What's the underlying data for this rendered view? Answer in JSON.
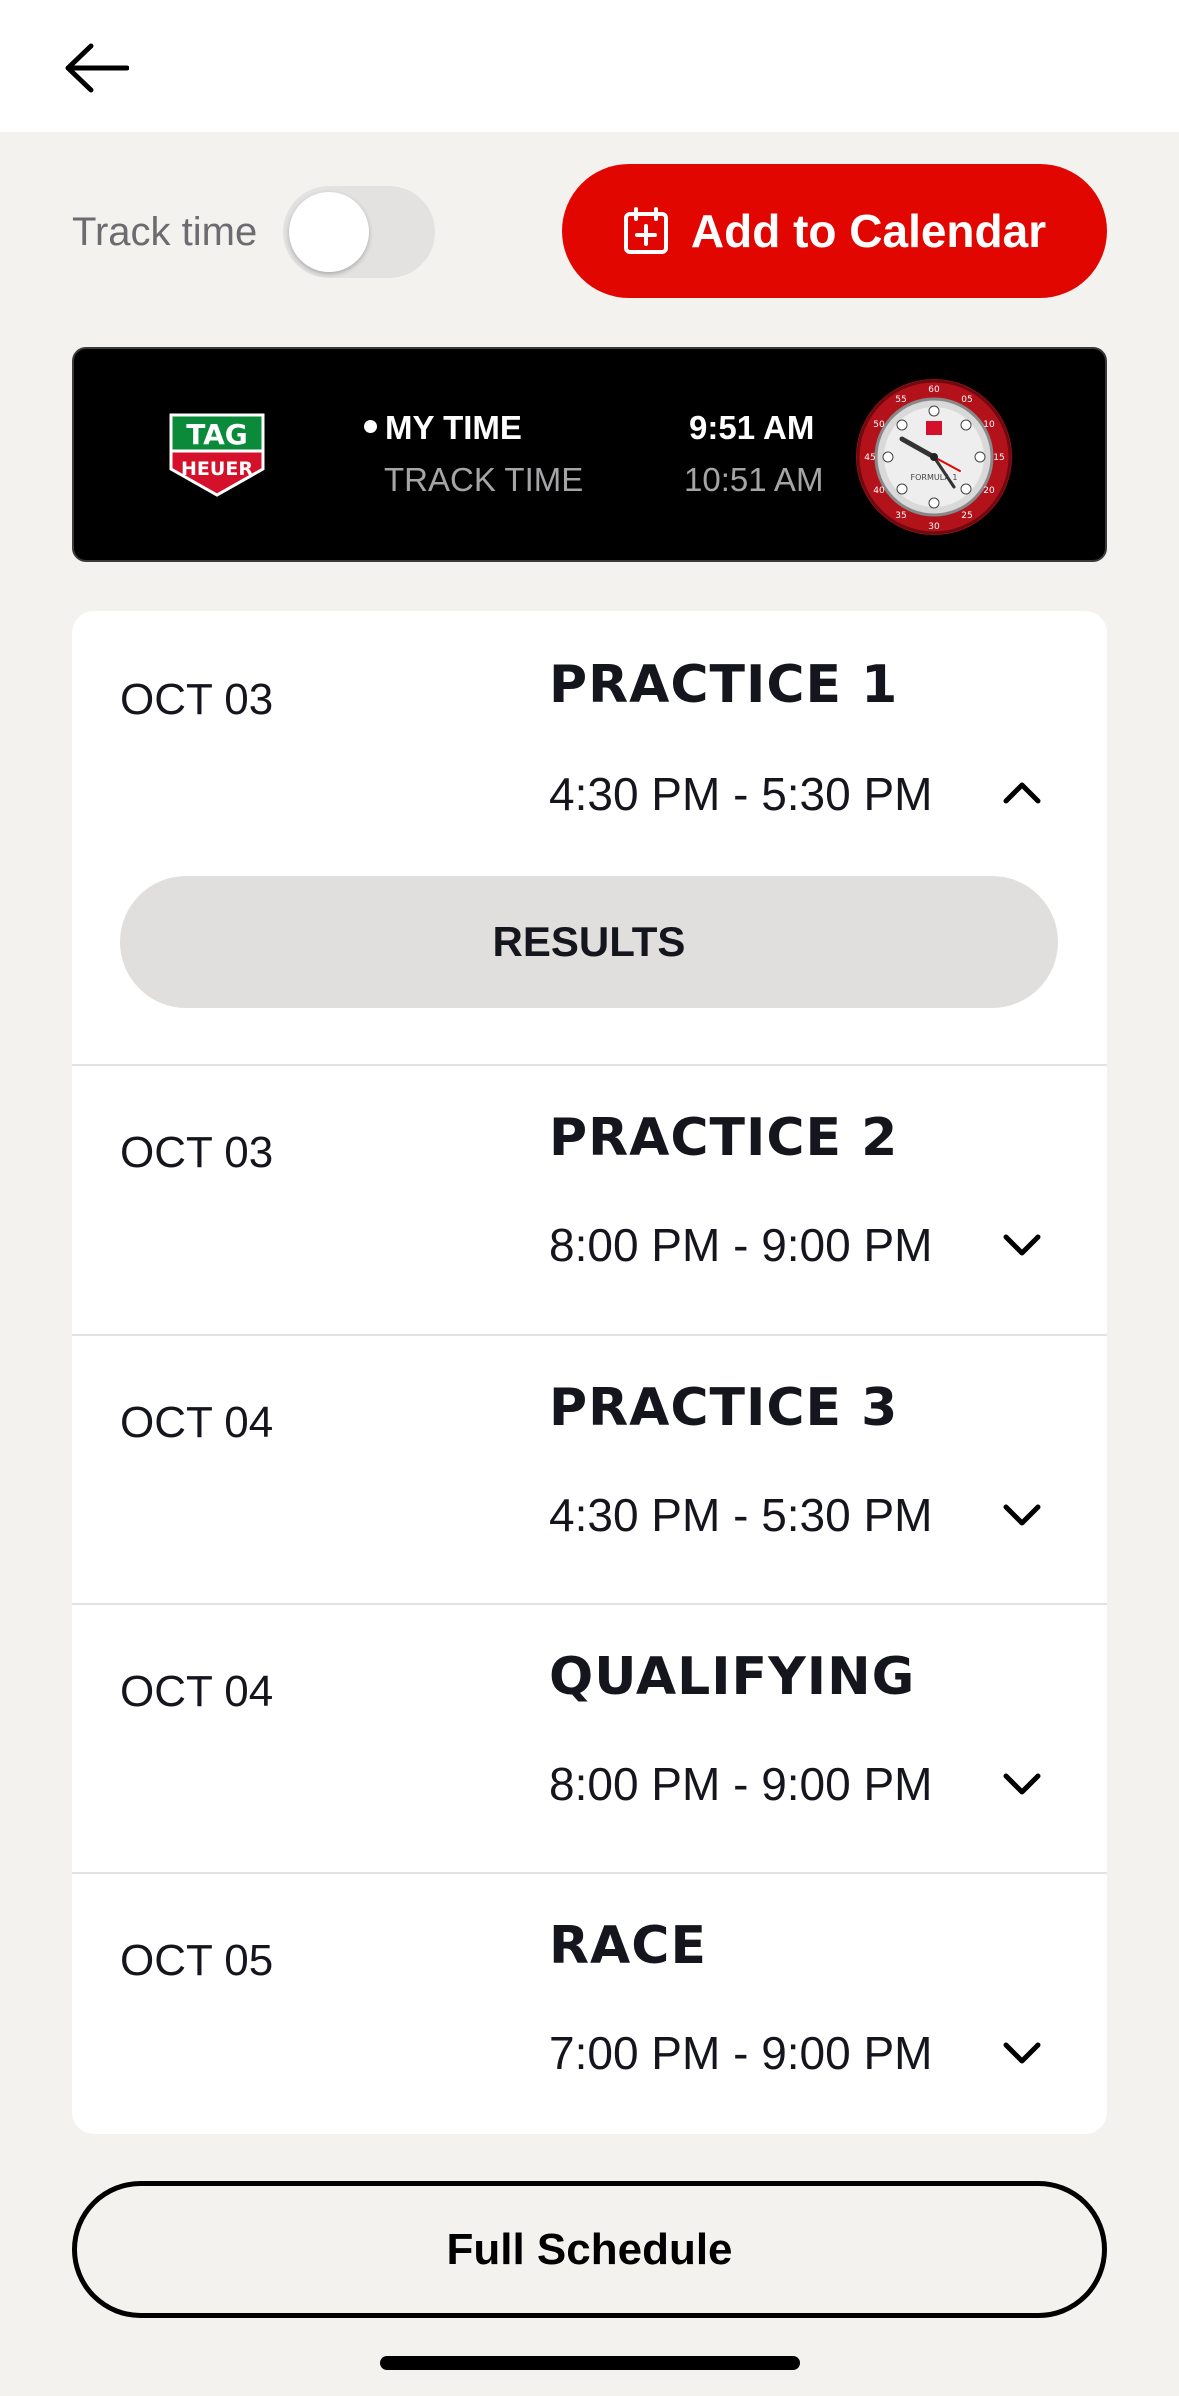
{
  "header": {
    "back_icon": "arrow-left-icon"
  },
  "track_toggle": {
    "label": "Track time",
    "on": false
  },
  "calendar_button": {
    "label": "Add to Calendar",
    "icon": "calendar-add-icon"
  },
  "time_banner": {
    "logo_text_top": "TAG",
    "logo_text_bottom": "HEUER",
    "my_time_label": "MY TIME",
    "my_time_value": "9:51 AM",
    "track_time_label": "TRACK TIME",
    "track_time_value": "10:51 AM",
    "watch_label": "FORMULA 1"
  },
  "sessions": [
    {
      "date": "OCT 03",
      "name": "PRACTICE 1",
      "time": "4:30 PM - 5:30 PM",
      "expanded": true,
      "results_label": "RESULTS"
    },
    {
      "date": "OCT 03",
      "name": "PRACTICE 2",
      "time": "8:00 PM - 9:00 PM",
      "expanded": false
    },
    {
      "date": "OCT 04",
      "name": "PRACTICE 3",
      "time": "4:30 PM - 5:30 PM",
      "expanded": false
    },
    {
      "date": "OCT 04",
      "name": "QUALIFYING",
      "time": "8:00 PM - 9:00 PM",
      "expanded": false
    },
    {
      "date": "OCT 05",
      "name": "RACE",
      "time": "7:00 PM - 9:00 PM",
      "expanded": false
    }
  ],
  "full_schedule_button": {
    "label": "Full Schedule"
  },
  "colors": {
    "accent": "#e10600",
    "background": "#f4f2ef",
    "card": "#ffffff",
    "banner": "#000000"
  }
}
